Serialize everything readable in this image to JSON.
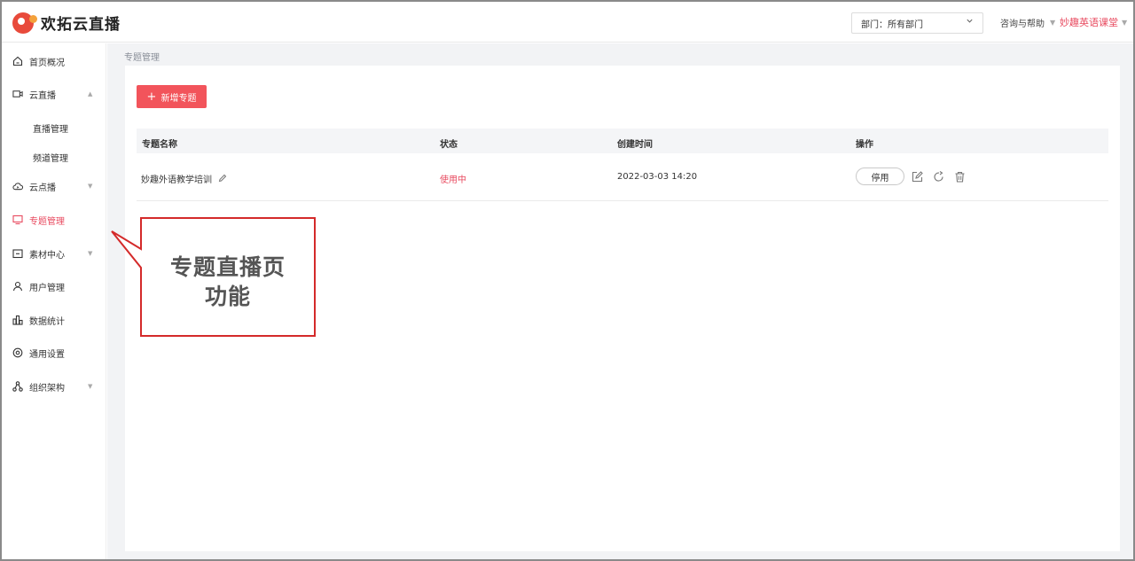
{
  "header": {
    "brand": "欢拓云直播",
    "dept_select": "部门：所有部门",
    "help": "咨询与帮助",
    "account": "妙趣英语课堂"
  },
  "sidebar": {
    "items": [
      {
        "label": "首页概况",
        "icon": "home-icon"
      },
      {
        "label": "云直播",
        "icon": "video-camera-icon",
        "arrow": "▲"
      },
      {
        "label": "云点播",
        "icon": "cloud-play-icon",
        "arrow": "▼"
      },
      {
        "label": "专题管理",
        "icon": "monitor-icon",
        "active": true
      },
      {
        "label": "素材中心",
        "icon": "folder-icon",
        "arrow": "▼"
      },
      {
        "label": "用户管理",
        "icon": "user-icon"
      },
      {
        "label": "数据统计",
        "icon": "bar-chart-icon"
      },
      {
        "label": "通用设置",
        "icon": "settings-icon"
      },
      {
        "label": "组织架构",
        "icon": "org-tree-icon",
        "arrow": "▼"
      }
    ],
    "subitems": [
      "直播管理",
      "频道管理"
    ]
  },
  "breadcrumb": "专题管理",
  "main": {
    "new_button": "新增专题",
    "columns": [
      "专题名称",
      "状态",
      "创建时间",
      "操作"
    ],
    "rows": [
      {
        "name": "妙趣外语教学培训",
        "status": "使用中",
        "created": "2022-03-03 14:20",
        "action": "停用"
      }
    ]
  },
  "callout": {
    "line1": "专题直播页",
    "line2": "功能"
  },
  "colors": {
    "accent": "#f2545b",
    "active_text": "#e84a5f",
    "callout_border": "#d42a2a"
  }
}
